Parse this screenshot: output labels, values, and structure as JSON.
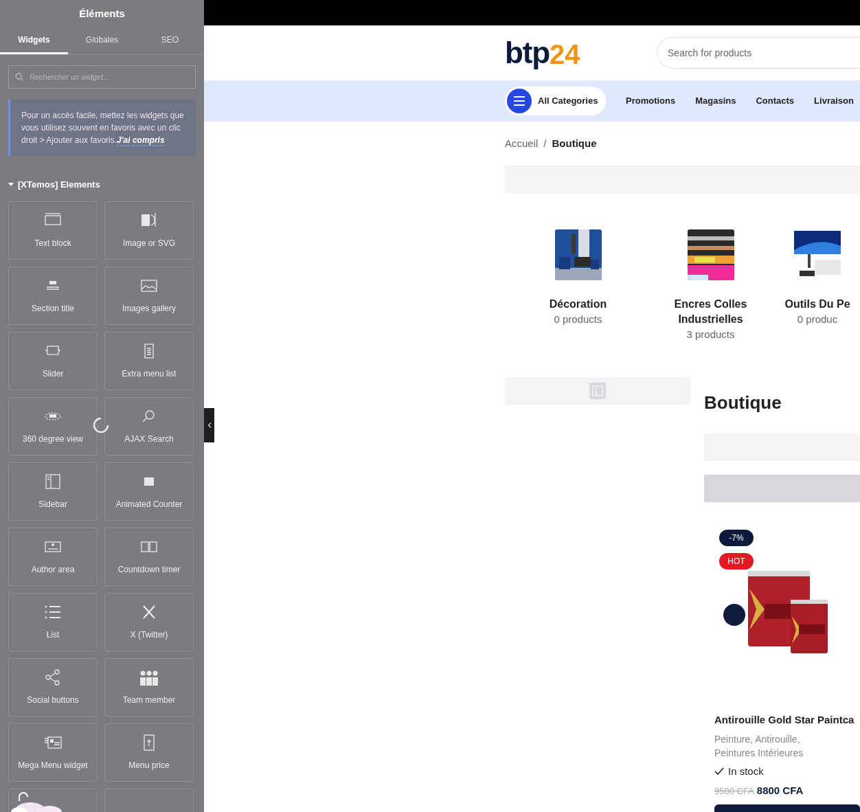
{
  "editor_panel": {
    "title": "Éléments",
    "tabs": [
      {
        "label": "Widgets",
        "selected": true
      },
      {
        "label": "Globales",
        "selected": false
      },
      {
        "label": "SEO",
        "selected": false
      }
    ],
    "search": {
      "placeholder": "Rechercher un widget…"
    },
    "notice": {
      "text": "Pour un accès facile, mettez les widgets que vous utilisez souvent en favoris avec un clic droit > Ajouter aux favoris.",
      "link": "J'ai compris"
    },
    "category": {
      "label": "[XTemos] Elements",
      "expanded": true
    },
    "widgets": [
      {
        "label": "Text block"
      },
      {
        "label": "Image or SVG"
      },
      {
        "label": "Section title"
      },
      {
        "label": "Images gallery"
      },
      {
        "label": "Slider"
      },
      {
        "label": "Extra menu list"
      },
      {
        "label": "360 degree view"
      },
      {
        "label": "AJAX Search"
      },
      {
        "label": "Sidebar"
      },
      {
        "label": "Animated Counter"
      },
      {
        "label": "Author area"
      },
      {
        "label": "Countdown timer"
      },
      {
        "label": "List"
      },
      {
        "label": "X (Twitter)"
      },
      {
        "label": "Social buttons"
      },
      {
        "label": "Team member"
      },
      {
        "label": "Mega Menu widget"
      },
      {
        "label": "Menu price"
      }
    ]
  },
  "site": {
    "logo": {
      "mark": "btp",
      "number": "24"
    },
    "search": {
      "placeholder": "Search for products"
    },
    "nav": {
      "categories_button": "All Categories",
      "links": [
        "Promotions",
        "Magasins",
        "Contacts",
        "Livraison"
      ]
    },
    "breadcrumb": [
      "Accueil",
      "/",
      "Boutique"
    ],
    "categories": [
      {
        "name": "Décoration",
        "count": "0 products",
        "kind": "picture"
      },
      {
        "name": "Encres Colles Industrielles",
        "count": "3 products",
        "kind": "picture"
      },
      {
        "name": "Outils Du Pe",
        "count": "0 produc",
        "kind": "picture"
      }
    ],
    "heading": "Boutique",
    "product": {
      "badges": [
        {
          "label": "-7%",
          "kind": "discount"
        },
        {
          "label": "HOT",
          "kind": "hot"
        }
      ],
      "title": "Antirouille Gold Star Paintca",
      "tags": "Peinture, Antirouille, Peintures Intérieures",
      "stock": {
        "label": "In stock",
        "in_stock": true
      },
      "old_price": "9500 CFA",
      "price": "8800 CFA"
    }
  }
}
